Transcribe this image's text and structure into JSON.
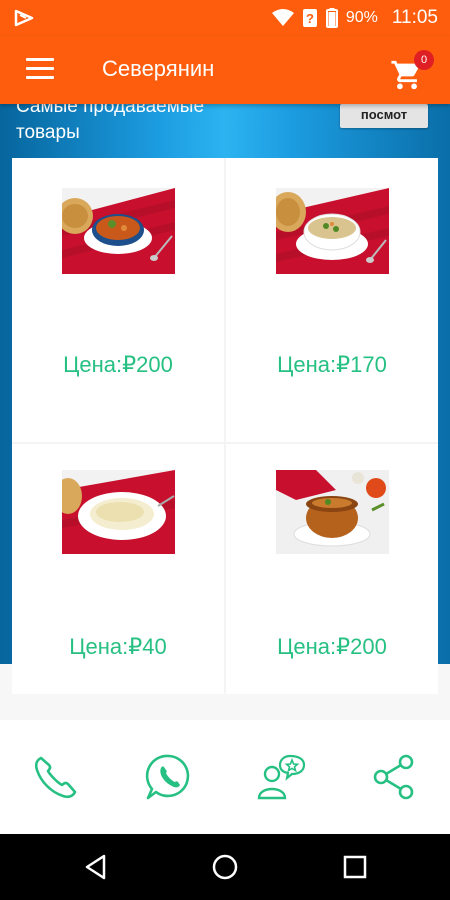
{
  "status_bar": {
    "battery": "90%",
    "time": "11:05"
  },
  "app_bar": {
    "title": "Северянин",
    "cart_count": "0"
  },
  "hero": {
    "title": "Самые продаваемые товары",
    "button": "посмот"
  },
  "products": [
    {
      "price": "Цена:₽200",
      "image": "soup-bowl-with-bread-photo"
    },
    {
      "price": "Цена:₽170",
      "image": "soup-white-bowl-photo"
    },
    {
      "price": "Цена:₽40",
      "image": "rice-plate-photo"
    },
    {
      "price": "Цена:₽200",
      "image": "clay-pot-soup-photo"
    }
  ],
  "bottom_actions": [
    "phone-icon",
    "whatsapp-icon",
    "contacts-chat-icon",
    "share-icon"
  ],
  "colors": {
    "brand": "#fd5d0c",
    "accent": "#27c083",
    "hero": "#1c9ce0",
    "badge": "#e01f25"
  }
}
